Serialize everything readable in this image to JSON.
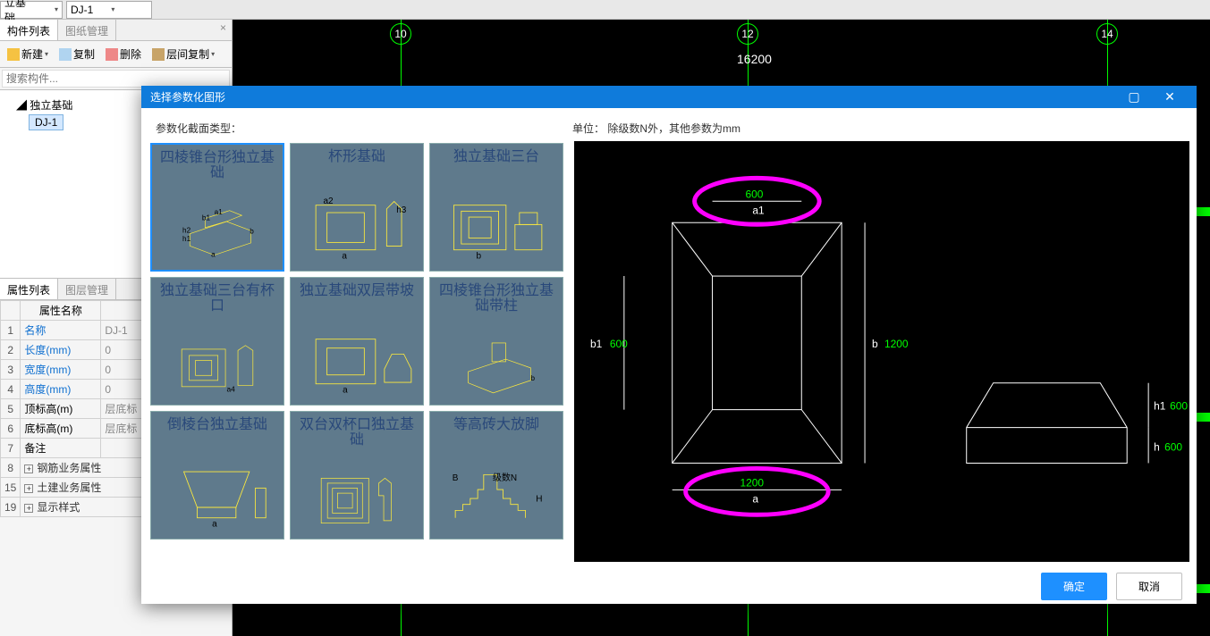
{
  "topbar": {
    "dropdown1": "立基础",
    "dropdown2": "DJ-1"
  },
  "left": {
    "tab1": "构件列表",
    "tab2": "图纸管理",
    "btn_new": "新建",
    "btn_copy": "复制",
    "btn_delete": "删除",
    "btn_layercopy": "层间复制",
    "search_ph": "搜索构件...",
    "tree_root": "独立基础",
    "tree_child": "DJ-1",
    "props_tab1": "属性列表",
    "props_tab2": "图层管理",
    "col_name": "属性名称",
    "col_value": "",
    "rows": [
      {
        "n": "1",
        "name": "名称",
        "link": true,
        "val": "DJ-1"
      },
      {
        "n": "2",
        "name": "长度(mm)",
        "link": true,
        "val": "0"
      },
      {
        "n": "3",
        "name": "宽度(mm)",
        "link": true,
        "val": "0"
      },
      {
        "n": "4",
        "name": "高度(mm)",
        "link": true,
        "val": "0"
      },
      {
        "n": "5",
        "name": "顶标高(m)",
        "link": false,
        "val": "层底标"
      },
      {
        "n": "6",
        "name": "底标高(m)",
        "link": false,
        "val": "层底标"
      },
      {
        "n": "7",
        "name": "备注",
        "link": false,
        "val": ""
      }
    ],
    "exp_rows": [
      {
        "n": "8",
        "label": "钢筋业务属性"
      },
      {
        "n": "15",
        "label": "土建业务属性"
      },
      {
        "n": "19",
        "label": "显示样式"
      }
    ]
  },
  "canvas": {
    "grid10": "10",
    "grid12": "12",
    "grid14": "14",
    "dim": "16200"
  },
  "dialog": {
    "title": "选择参数化图形",
    "label_type": "参数化截面类型：",
    "label_unit": "单位： 除级数N外，其他参数为mm",
    "shapes": [
      "四棱锥台形独立基础",
      "杯形基础",
      "独立基础三台",
      "独立基础三台有杯口",
      "独立基础双层带坡",
      "四棱锥台形独立基础带柱",
      "倒棱台独立基础",
      "双台双杯口独立基础",
      "等高砖大放脚"
    ],
    "preview": {
      "a1_val": "600",
      "a1_lbl": "a1",
      "b1_val": "600",
      "b1_lbl": "b1",
      "b_val": "1200",
      "b_lbl": "b",
      "a_val": "1200",
      "a_lbl": "a",
      "h1_val": "600",
      "h1_lbl": "h1",
      "h_val": "600",
      "h_lbl": "h"
    },
    "ok": "确定",
    "cancel": "取消"
  }
}
